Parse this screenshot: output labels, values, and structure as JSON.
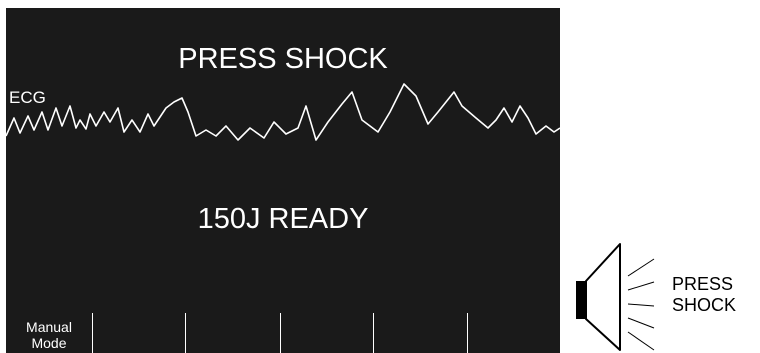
{
  "monitor": {
    "prompt_top": "PRESS SHOCK",
    "prompt_status": "150J READY",
    "lead_label": "ECG"
  },
  "softkeys": [
    {
      "line1": "Manual",
      "line2": "Mode"
    },
    {
      "line1": "",
      "line2": ""
    },
    {
      "line1": "",
      "line2": ""
    },
    {
      "line1": "",
      "line2": ""
    },
    {
      "line1": "",
      "line2": ""
    },
    {
      "line1": "",
      "line2": ""
    }
  ],
  "voice_prompt": {
    "line1": "PRESS",
    "line2": "SHOCK",
    "icon": "speaker-icon"
  },
  "colors": {
    "screen_background": "#1a1a1a",
    "screen_text": "#ffffff",
    "trace": "#ffffff"
  }
}
